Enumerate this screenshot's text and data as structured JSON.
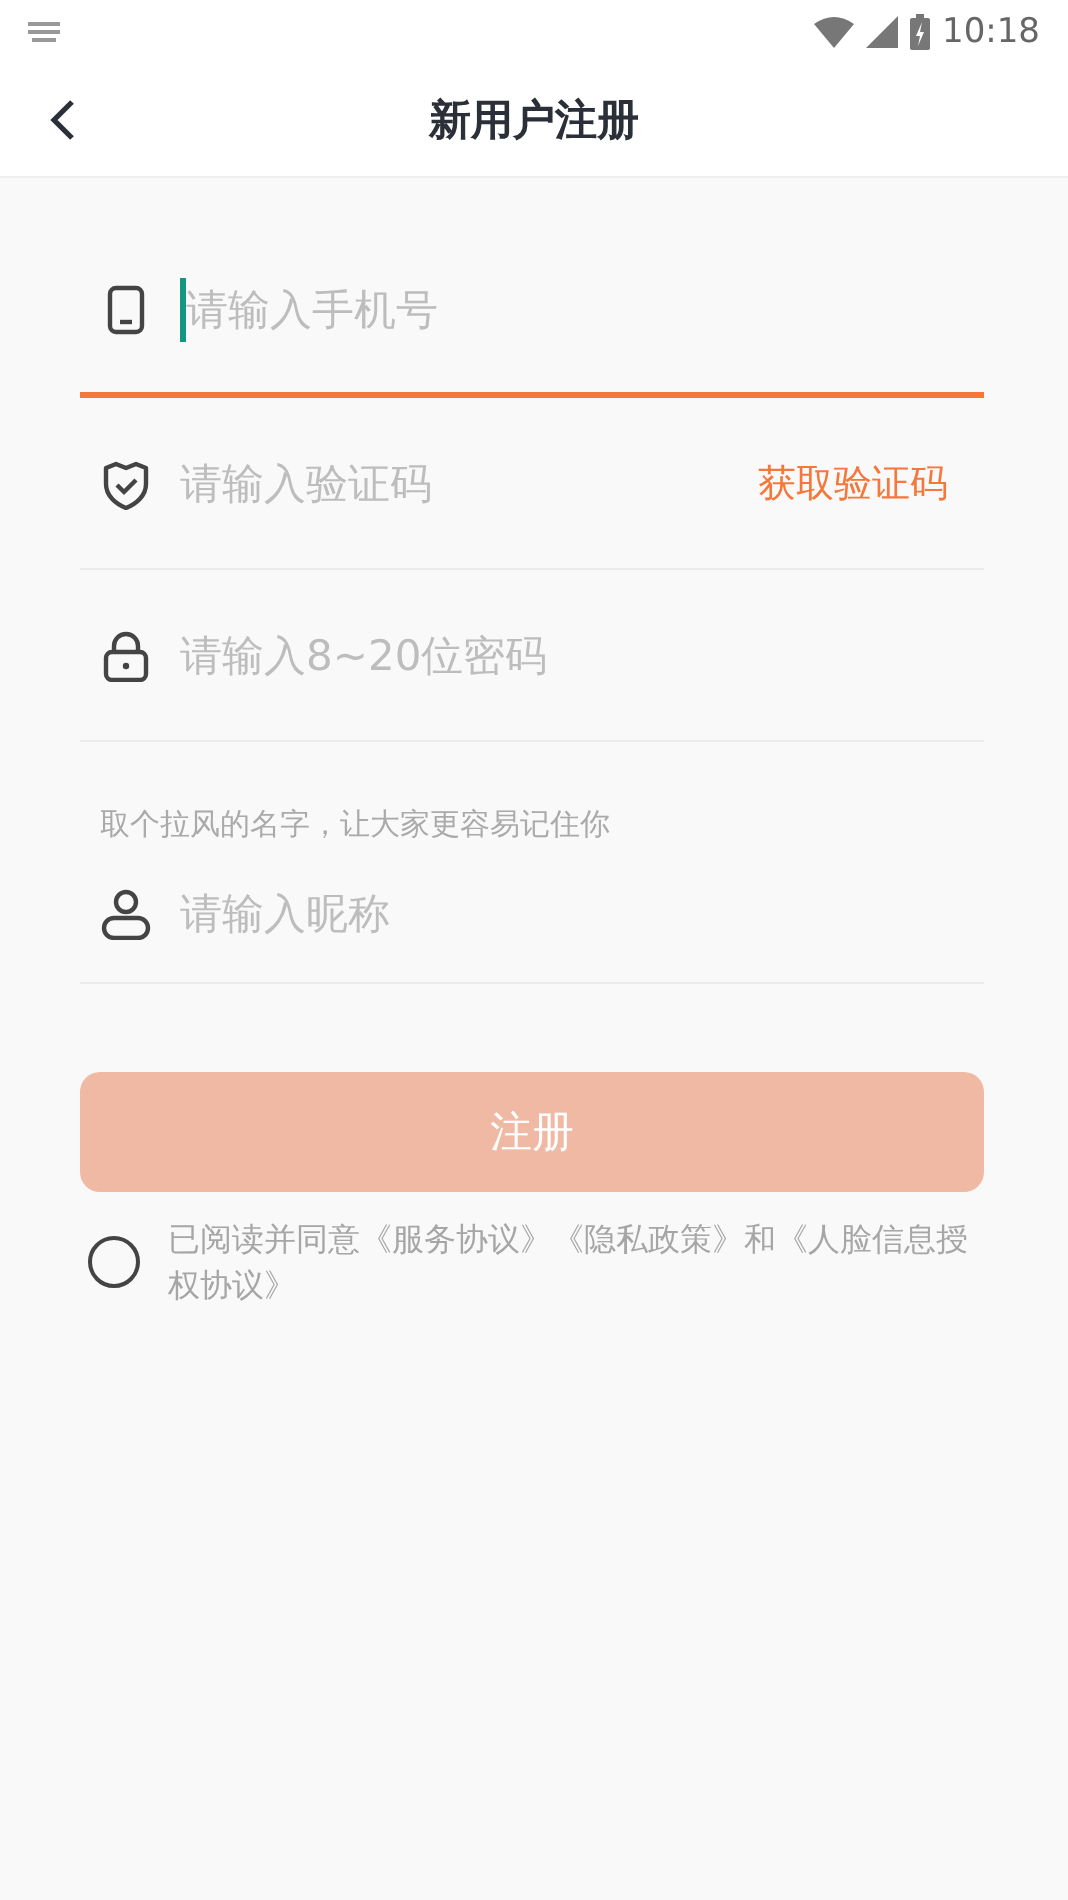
{
  "status_bar": {
    "time": "10:18"
  },
  "header": {
    "title": "新用户注册"
  },
  "fields": [
    {
      "kind": "phone",
      "placeholder": "请输入手机号",
      "focused": true
    },
    {
      "kind": "code",
      "placeholder": "请输入验证码",
      "focused": false,
      "action": "获取验证码"
    },
    {
      "kind": "password",
      "placeholder": "请输入8~20位密码",
      "focused": false
    },
    {
      "kind": "nickname",
      "placeholder": "请输入昵称",
      "focused": false,
      "hint": "取个拉风的名字，让大家更容易记住你"
    }
  ],
  "register_button": {
    "label": "注册",
    "disabled": true
  },
  "agreement": {
    "checked": false,
    "text": "已阅读并同意《服务协议》《隐私政策》和《人脸信息授权协议》"
  }
}
